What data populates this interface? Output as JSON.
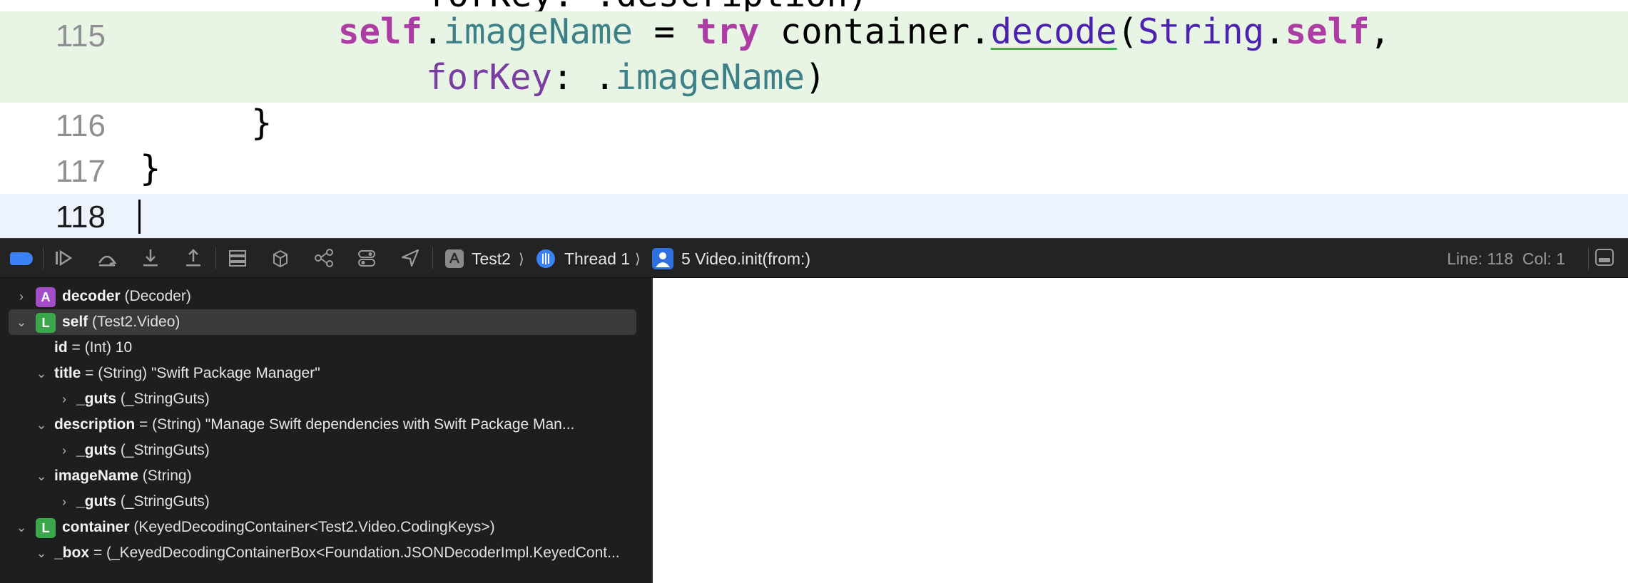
{
  "editor": {
    "partial_line": {
      "code": "forKey: .description)"
    },
    "lines": [
      {
        "number": "115",
        "part1": {
          "kw_self": "self",
          "dot1": ".",
          "prop_imageName": "imageName",
          "eq": " = ",
          "kw_try": "try",
          "container": " container.",
          "method_decode": "decode",
          "paren_open": "(",
          "type_String": "String",
          "dot2": ".",
          "kw_self2": "self",
          "comma": ","
        },
        "part2": {
          "label_forKey": "forKey",
          "colon": ": ",
          "dot": ".",
          "prop_imageName": "imageName",
          "paren_close": ")"
        }
      },
      {
        "number": "116",
        "code": "}"
      },
      {
        "number": "117",
        "code": "}"
      },
      {
        "number": "118",
        "code": ""
      }
    ]
  },
  "debug_bar": {
    "icons": [
      "breakpoints-toggle-icon",
      "continue-icon",
      "step-over-icon",
      "step-into-icon",
      "step-out-icon",
      "view-hierarchy-icon",
      "memory-graph-icon",
      "environment-icon",
      "simulate-location-icon",
      "location-icon"
    ],
    "breadcrumb": {
      "target": "Test2",
      "thread": "Thread 1",
      "frame": "5 Video.init(from:)"
    },
    "status": {
      "line": "Line: 118",
      "col": "Col: 1"
    },
    "colors": {
      "accent": "#3b82f6",
      "thread_icon": "#3b82f6",
      "frame_icon": "#2f6fde"
    }
  },
  "variables": [
    {
      "disclosure": "›",
      "badge": "A",
      "name": "decoder",
      "type": "(Decoder)",
      "value": ""
    },
    {
      "disclosure": "⌄",
      "badge": "L",
      "name": "self",
      "type": "(Test2.Video)",
      "value": ""
    },
    {
      "disclosure": "",
      "badge": "",
      "name": "id",
      "type": " = (Int)",
      "value": " 10"
    },
    {
      "disclosure": "⌄",
      "badge": "",
      "name": "title",
      "type": " = (String)",
      "value": " \"Swift Package Manager\""
    },
    {
      "disclosure": "›",
      "badge": "",
      "name": "_guts",
      "type": "(_StringGuts)",
      "value": ""
    },
    {
      "disclosure": "⌄",
      "badge": "",
      "name": "description",
      "type": " = (String)",
      "value": " \"Manage Swift dependencies with Swift Package Man..."
    },
    {
      "disclosure": "›",
      "badge": "",
      "name": "_guts",
      "type": "(_StringGuts)",
      "value": ""
    },
    {
      "disclosure": "⌄",
      "badge": "",
      "name": "imageName",
      "type": "(String)",
      "value": ""
    },
    {
      "disclosure": "›",
      "badge": "",
      "name": "_guts",
      "type": "(_StringGuts)",
      "value": ""
    },
    {
      "disclosure": "⌄",
      "badge": "L",
      "name": "container",
      "type": "(KeyedDecodingContainer<Test2.Video.CodingKeys>)",
      "value": ""
    },
    {
      "disclosure": "⌄",
      "badge": "",
      "name": "_box",
      "type": " = (_KeyedDecodingContainerBox<Foundation.JSONDecoderImpl.KeyedCont...",
      "value": ""
    }
  ]
}
